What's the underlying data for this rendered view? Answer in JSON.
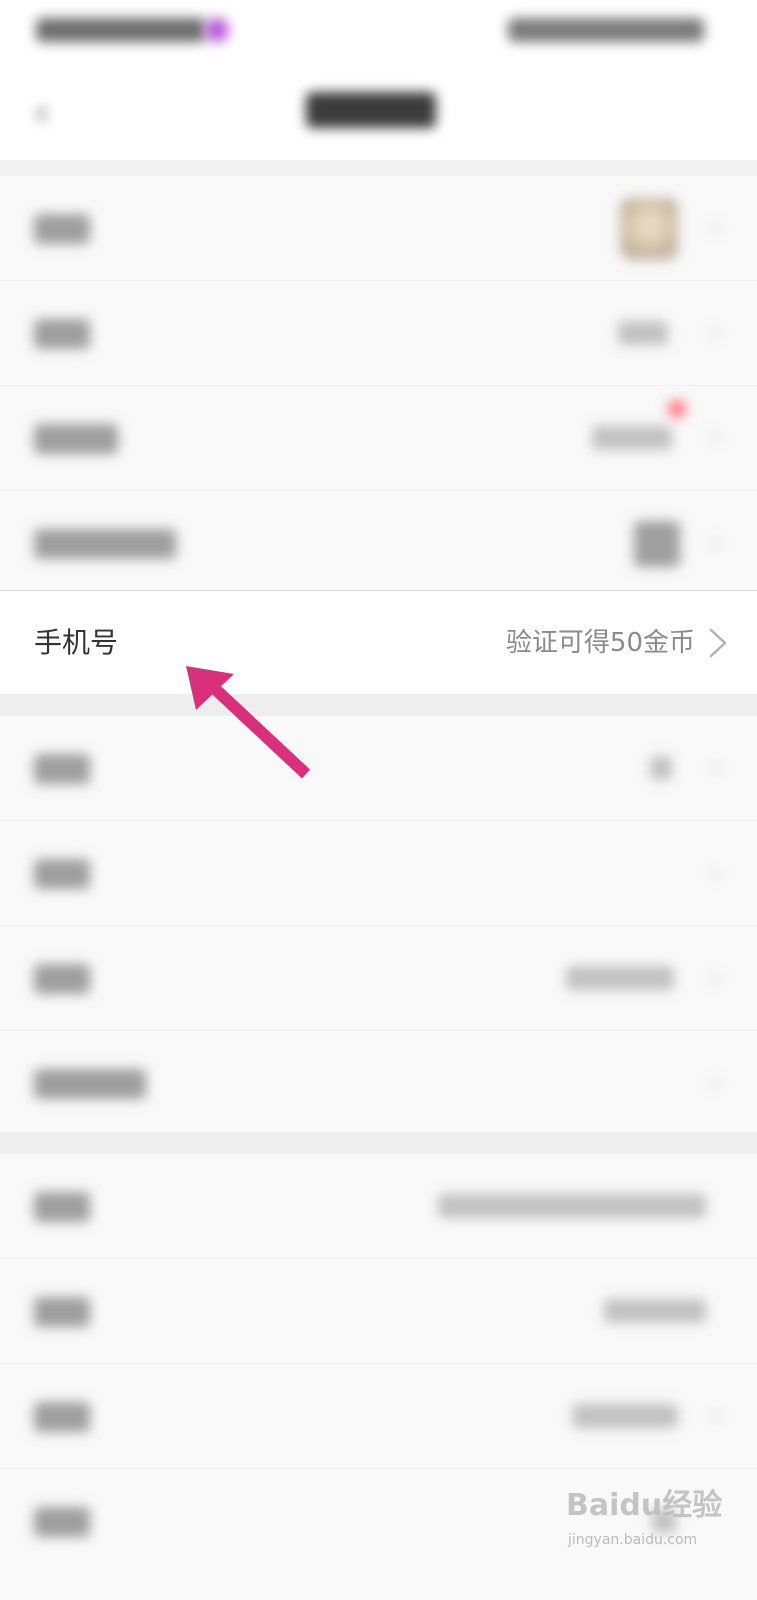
{
  "phone_row": {
    "label": "手机号",
    "value": "验证可得50金币"
  },
  "watermark": {
    "brand": "Baidu经验",
    "url": "jingyan.baidu.com"
  },
  "colors": {
    "arrow": "#d8307a",
    "background": "#f2f2f2",
    "label_text": "#333333",
    "value_text": "#8a8a8a"
  },
  "icons": {
    "chevron": "chevron-right-icon",
    "back": "back-arrow-icon",
    "annotation": "pointer-arrow-icon"
  }
}
